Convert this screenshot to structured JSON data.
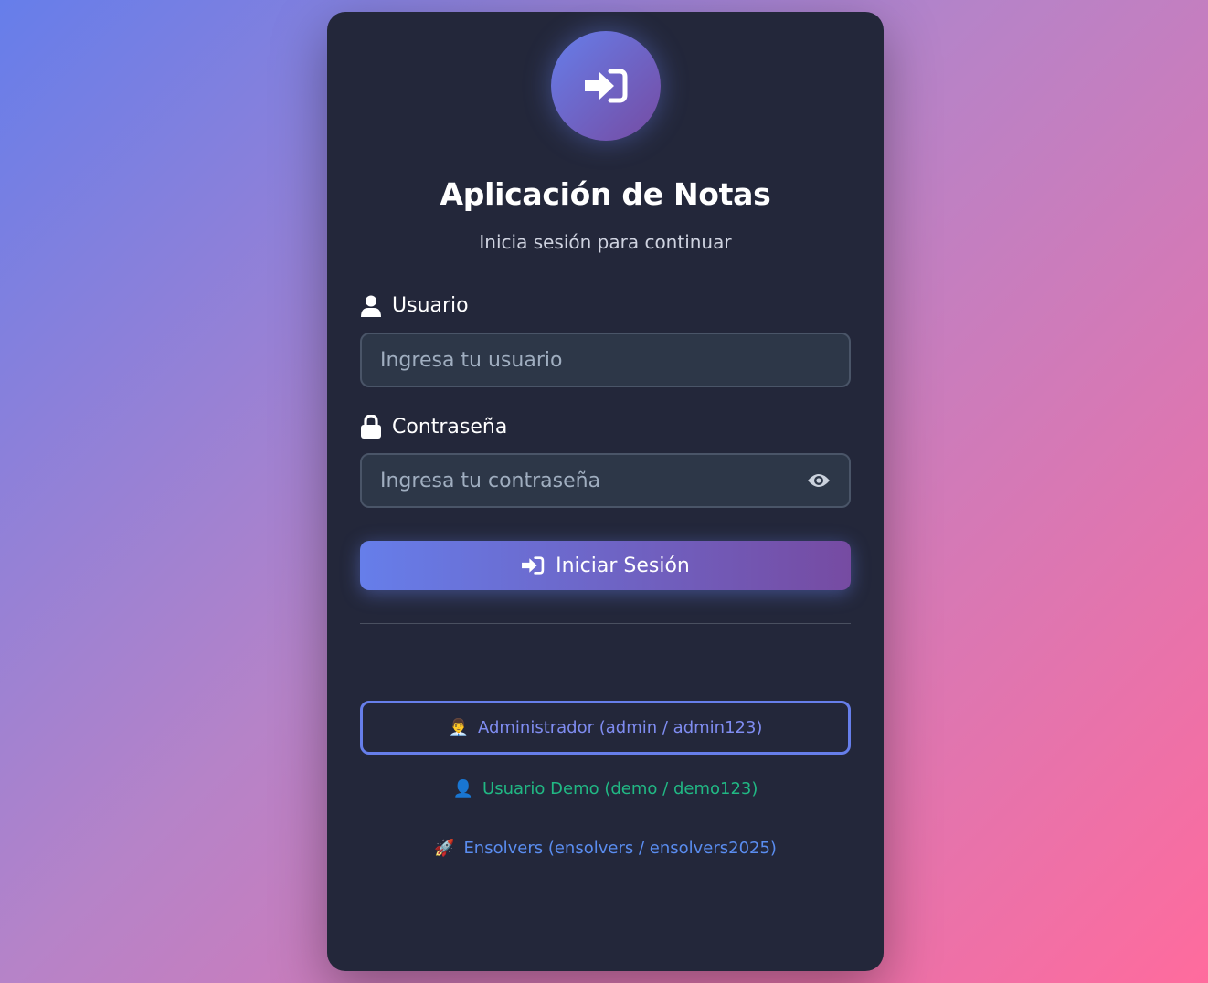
{
  "app": {
    "title": "Aplicación de Notas",
    "subtitle": "Inicia sesión para continuar"
  },
  "form": {
    "username_label": "Usuario",
    "username_placeholder": "Ingresa tu usuario",
    "password_label": "Contraseña",
    "password_placeholder": "Ingresa tu contraseña",
    "submit_label": "Iniciar Sesión"
  },
  "demo_accounts": [
    {
      "icon": "👨‍💼",
      "label": "Administrador (admin / admin123)"
    },
    {
      "icon": "👤",
      "label": "Usuario Demo (demo / demo123)"
    },
    {
      "icon": "🚀",
      "label": "Ensolvers (ensolvers / ensolvers2025)"
    }
  ],
  "icons": {
    "logo": "sign-in-icon",
    "username": "user-icon",
    "password": "lock-icon",
    "toggle_password": "eye-icon",
    "submit": "sign-in-icon"
  },
  "colors": {
    "accent_start": "#667eea",
    "accent_end": "#764ba2",
    "card_bg": "#23273a",
    "admin_text": "#7f8cf0",
    "demo_text": "#21b884",
    "ensolvers_text": "#5a8df0"
  }
}
